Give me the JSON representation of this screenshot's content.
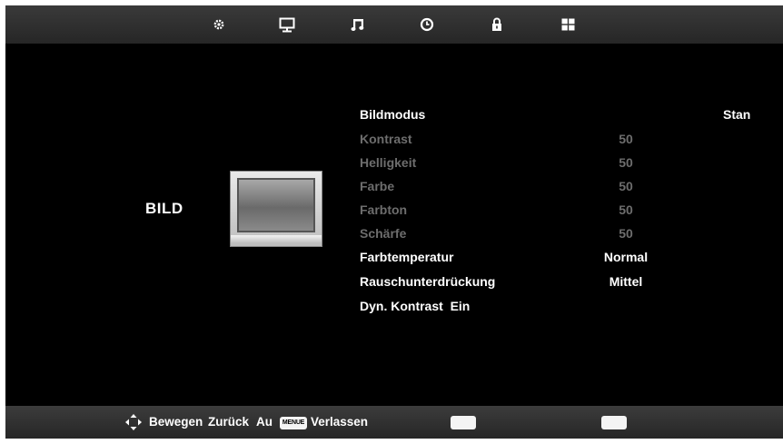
{
  "tabs": [
    {
      "icon": "gear-icon"
    },
    {
      "icon": "monitor-icon"
    },
    {
      "icon": "music-note-icon"
    },
    {
      "icon": "clock-icon"
    },
    {
      "icon": "lock-icon"
    },
    {
      "icon": "grid-icon"
    }
  ],
  "section": {
    "title": "BILD"
  },
  "menu": [
    {
      "label": "Bildmodus",
      "value": "Stan",
      "state": "active"
    },
    {
      "label": "Kontrast",
      "value": "50",
      "state": "dim"
    },
    {
      "label": "Helligkeit",
      "value": "50",
      "state": "dim"
    },
    {
      "label": "Farbe",
      "value": "50",
      "state": "dim"
    },
    {
      "label": "Farbton",
      "value": "50",
      "state": "dim"
    },
    {
      "label": "Schärfe",
      "value": "50",
      "state": "dim"
    },
    {
      "label": "Farbtemperatur",
      "value": "Normal",
      "state": "active"
    },
    {
      "label": "Rauschunterdrückung",
      "value": "Mittel",
      "state": "active"
    },
    {
      "label": "Dyn. Kontrast  Ein",
      "value": "",
      "state": "active"
    }
  ],
  "footer": {
    "move": "Bewegen",
    "back": "Zurück",
    "au": "Au",
    "menu_key": "MENUE",
    "exit": "Verlassen"
  },
  "colors": {
    "active_text": "#ffffff",
    "dim_text": "#6d6d6d",
    "background": "#000000"
  }
}
